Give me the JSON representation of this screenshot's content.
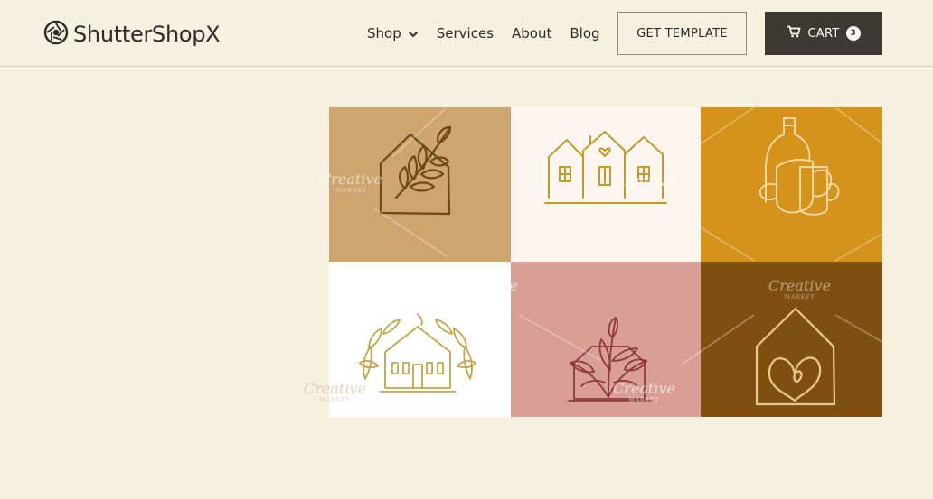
{
  "brand": {
    "name": "ShutterShopX",
    "logo_icon": "camera-aperture-icon"
  },
  "nav": {
    "items": [
      {
        "label": "Shop",
        "has_dropdown": true
      },
      {
        "label": "Services"
      },
      {
        "label": "About"
      },
      {
        "label": "Blog"
      }
    ]
  },
  "actions": {
    "template_label": "GET TEMPLATE",
    "cart_label": "CART",
    "cart_count": "3",
    "cart_icon": "shopping-cart-icon"
  },
  "gallery": {
    "watermark_title": "Creative",
    "watermark_sub": "MARKET",
    "tiles": [
      {
        "name": "house-leaf-logo",
        "background": "#cea56f",
        "line_color": "#6b4a16"
      },
      {
        "name": "three-houses-logo",
        "background": "#fdf5ef",
        "line_color": "#c39a2b"
      },
      {
        "name": "bottle-cups-logo",
        "background": "#d6931c",
        "line_color": "#f3dfb0"
      },
      {
        "name": "house-wreath-logo",
        "background": "#ffffff",
        "line_color": "#c9a445"
      },
      {
        "name": "house-plant-logo",
        "background": "#d99e94",
        "line_color": "#8e3a3a"
      },
      {
        "name": "house-heart-logo",
        "background": "#7f4f12",
        "line_color": "#e8c98e"
      }
    ]
  },
  "colors": {
    "page_bg": "#f6f1df",
    "cart_button_bg": "#3d3a36",
    "text": "#2b2b2b"
  }
}
